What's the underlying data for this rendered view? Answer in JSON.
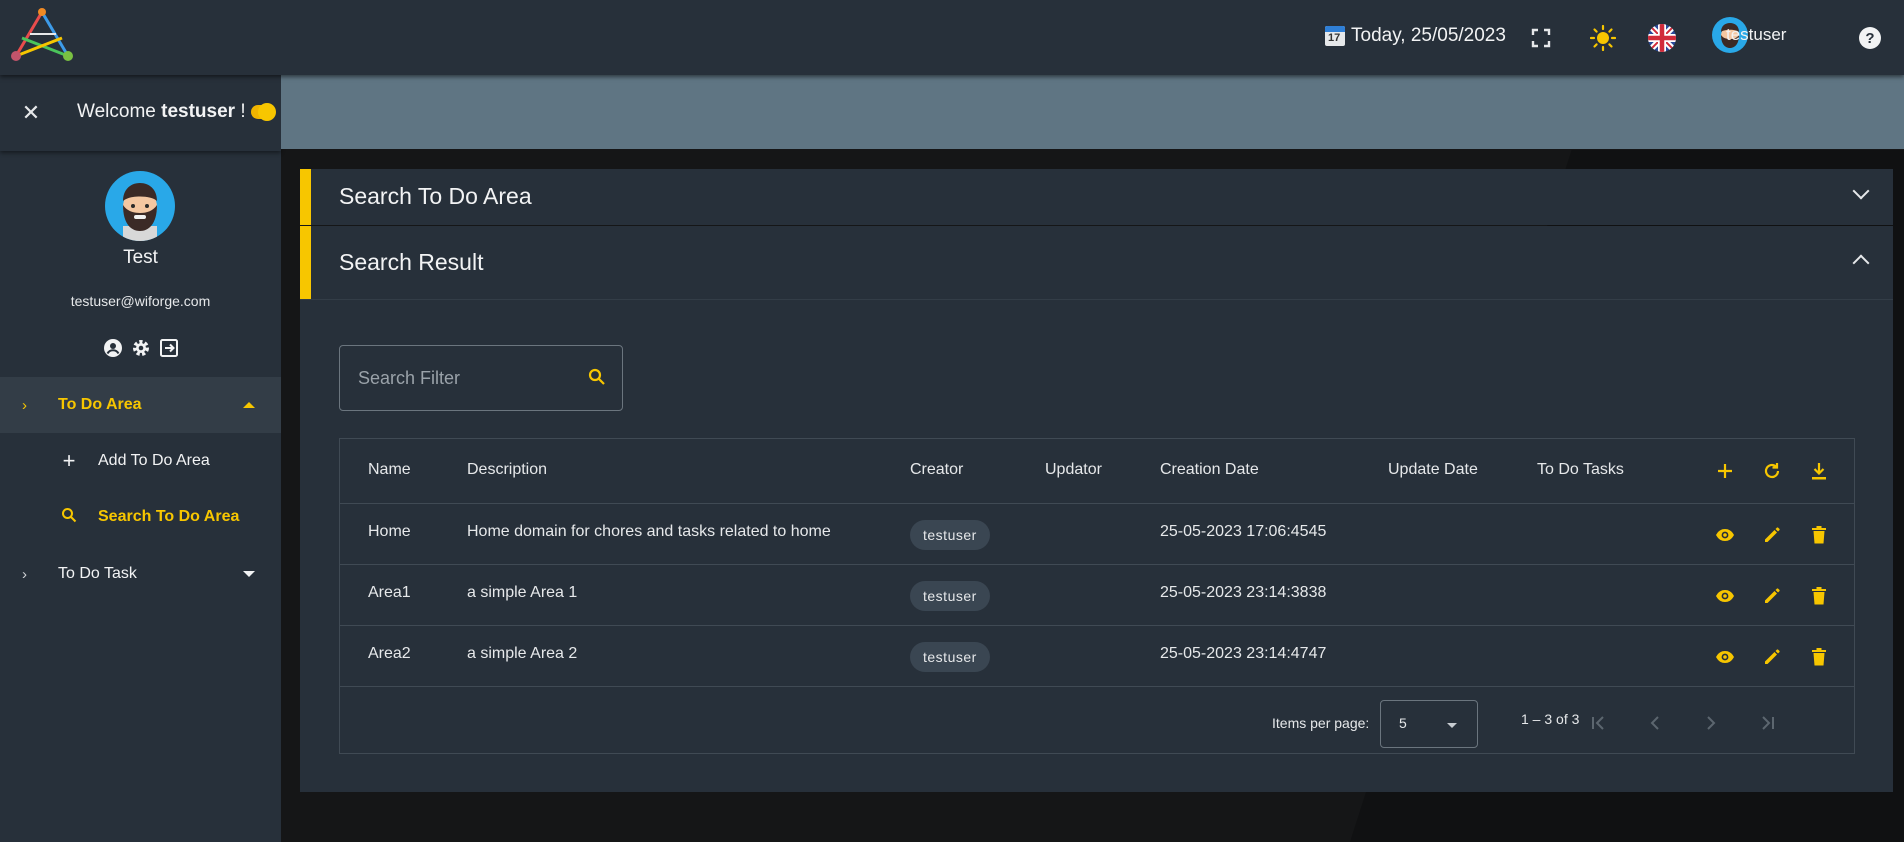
{
  "topbar": {
    "date_text": "Today, 25/05/2023",
    "calendar_day": "17",
    "username": "testuser"
  },
  "sidebar": {
    "welcome_prefix": "Welcome",
    "welcome_user": "testuser",
    "welcome_suffix": " !",
    "profile_name": "Test",
    "profile_email": "testuser@wiforge.com",
    "nav": [
      {
        "label": "To Do Area",
        "active": true
      },
      {
        "label": "To Do Task",
        "active": false
      }
    ],
    "sub_items": [
      {
        "label": "Add To Do Area"
      },
      {
        "label": "Search To Do Area"
      }
    ]
  },
  "main": {
    "search_panel_title": "Search To Do Area",
    "result_panel_title": "Search Result",
    "search_placeholder": "Search Filter",
    "columns": [
      "Name",
      "Description",
      "Creator",
      "Updator",
      "Creation Date",
      "Update Date",
      "To Do Tasks"
    ],
    "rows": [
      {
        "name": "Home",
        "description": "Home domain for chores and tasks related to home",
        "creator": "testuser",
        "updator": "",
        "creation_date": "25-05-2023 17:06:4545",
        "update_date": "",
        "tasks": ""
      },
      {
        "name": "Area1",
        "description": "a simple Area 1",
        "creator": "testuser",
        "updator": "",
        "creation_date": "25-05-2023 23:14:3838",
        "update_date": "",
        "tasks": ""
      },
      {
        "name": "Area2",
        "description": "a simple Area 2",
        "creator": "testuser",
        "updator": "",
        "creation_date": "25-05-2023 23:14:4747",
        "update_date": "",
        "tasks": ""
      }
    ],
    "paginator": {
      "items_per_page_label": "Items per page:",
      "items_per_page": "5",
      "range": "1 – 3 of 3"
    }
  },
  "colors": {
    "accent": "#f7c600",
    "panel": "#27303a",
    "banner": "#5f7583"
  }
}
